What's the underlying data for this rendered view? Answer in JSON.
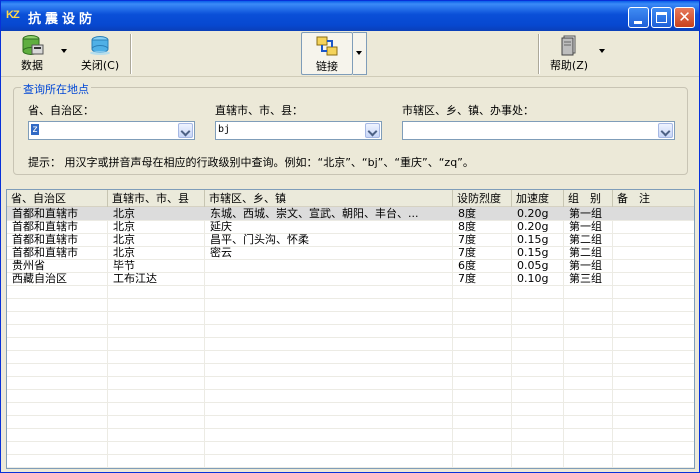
{
  "window": {
    "app_icon_text": "KZ",
    "title": "抗震设防"
  },
  "toolbar": {
    "data_label": "数据",
    "close_label": "关闭(C)",
    "link_label": "链接",
    "help_label": "帮助(Z)"
  },
  "query": {
    "group_title": "查询所在地点",
    "province_label": "省、自治区：",
    "province_value": "z",
    "city_label": "直辖市、市、县：",
    "city_value": "bj",
    "district_label": "市辖区、乡、镇、办事处：",
    "district_value": "",
    "hint": "提示： 用汉字或拼音声母在相应的行政级别中查询。例如：“北京”、“bj”、“重庆”、“zq”。"
  },
  "table": {
    "columns": [
      "省、自治区",
      "直辖市、市、县",
      "市辖区、乡、镇",
      "设防烈度",
      "加速度",
      "组　别",
      "备　注"
    ],
    "rows": [
      [
        "首都和直辖市",
        "北京",
        "东城、西城、崇文、宣武、朝阳、丰台、...",
        "8度",
        "0.20g",
        "第一组",
        ""
      ],
      [
        "首都和直辖市",
        "北京",
        "延庆",
        "8度",
        "0.20g",
        "第一组",
        ""
      ],
      [
        "首都和直辖市",
        "北京",
        "昌平、门头沟、怀柔",
        "7度",
        "0.15g",
        "第二组",
        ""
      ],
      [
        "首都和直辖市",
        "北京",
        "密云",
        "7度",
        "0.15g",
        "第二组",
        ""
      ],
      [
        "贵州省",
        "毕节",
        "",
        "6度",
        "0.05g",
        "第一组",
        ""
      ],
      [
        "西藏自治区",
        "工布江达",
        "",
        "7度",
        "0.10g",
        "第三组",
        ""
      ]
    ]
  },
  "colors": {
    "titlebar": "#0a4fd8",
    "group_title": "#0046d5",
    "selection": "#316ac5"
  }
}
